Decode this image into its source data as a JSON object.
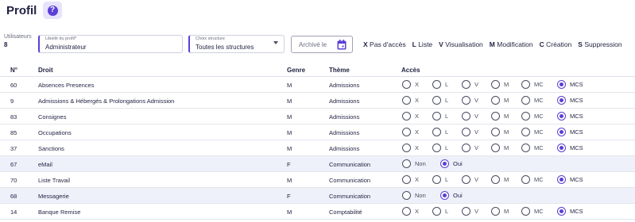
{
  "header": {
    "title": "Profil",
    "help_icon_glyph": "?"
  },
  "users": {
    "label": "Utilisateurs",
    "count": "8"
  },
  "profile_field": {
    "label": "Libellé du profil",
    "required_mark": "*",
    "value": "Administrateur"
  },
  "structure_field": {
    "label": "Choix structure",
    "value": "Toutes les structures"
  },
  "archive_field": {
    "placeholder": "Archivé le"
  },
  "legend": [
    {
      "key": "X",
      "text": "Pas d'accès"
    },
    {
      "key": "L",
      "text": "Liste"
    },
    {
      "key": "V",
      "text": "Visualisation"
    },
    {
      "key": "M",
      "text": "Modification"
    },
    {
      "key": "C",
      "text": "Création"
    },
    {
      "key": "S",
      "text": "Suppression"
    }
  ],
  "table": {
    "columns": {
      "num": "N°",
      "droit": "Droit",
      "genre": "Genre",
      "theme": "Thème",
      "acces": "Accès"
    },
    "level_options": [
      "X",
      "L",
      "V",
      "M",
      "MC",
      "MCS"
    ],
    "boolean_options": [
      "Non",
      "Oui"
    ],
    "rows": [
      {
        "num": "60",
        "droit": "Absences Presences",
        "genre": "M",
        "theme": "Admissions",
        "selected": "MCS"
      },
      {
        "num": "9",
        "droit": "Admissions & Hébergés & Prolongations Admission",
        "genre": "M",
        "theme": "Admissions",
        "selected": "MCS"
      },
      {
        "num": "83",
        "droit": "Consignes",
        "genre": "M",
        "theme": "Admissions",
        "selected": "MCS"
      },
      {
        "num": "85",
        "droit": "Occupations",
        "genre": "M",
        "theme": "Admissions",
        "selected": "MCS"
      },
      {
        "num": "37",
        "droit": "Sanctions",
        "genre": "M",
        "theme": "Admissions",
        "selected": "MCS"
      },
      {
        "num": "67",
        "droit": "eMail",
        "genre": "F",
        "theme": "Communication",
        "selected": "Oui"
      },
      {
        "num": "70",
        "droit": "Liste Travail",
        "genre": "M",
        "theme": "Communication",
        "selected": "MCS"
      },
      {
        "num": "68",
        "droit": "Messagerie",
        "genre": "F",
        "theme": "Communication",
        "selected": "Oui"
      },
      {
        "num": "14",
        "droit": "Banque Remise",
        "genre": "M",
        "theme": "Comptabilité",
        "selected": "MCS"
      }
    ]
  },
  "colors": {
    "accent": "#5b3fd6",
    "accent_soft": "#e6e3fb",
    "row_alt": "#eef0fa",
    "text": "#1f2140"
  }
}
